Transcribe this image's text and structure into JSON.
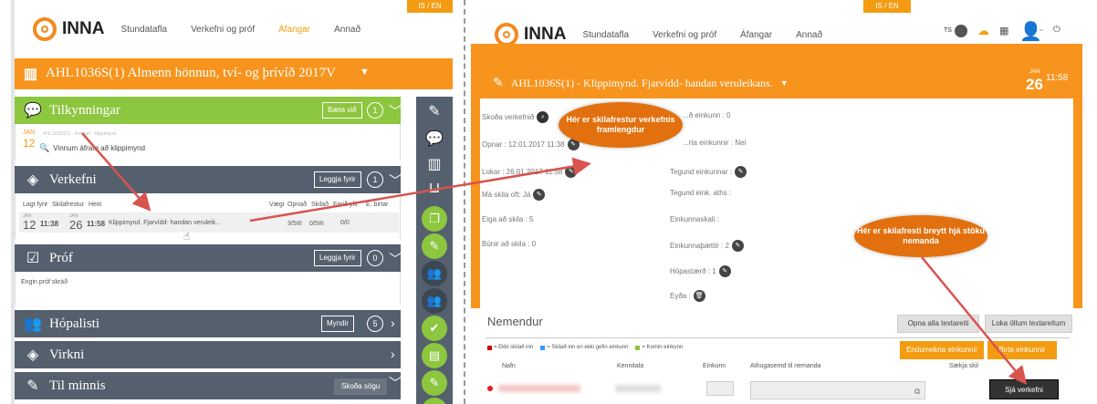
{
  "left": {
    "lang": "IS / EN",
    "logo": "INNA",
    "nav": [
      "Stundatafla",
      "Verkefni og próf",
      "Áfangar",
      "Annað"
    ],
    "course_title": "AHL1036S(1) Almenn hönnun, tví- og þrívíð 2017V",
    "sections": {
      "tilkynningar": {
        "title": "Tilkynningar",
        "button": "Bæta við",
        "count": "1"
      },
      "verkefni": {
        "title": "Verkefni",
        "button": "Leggja fyrir",
        "count": "1"
      },
      "prof": {
        "title": "Próf",
        "button": "Leggja fyrir",
        "count": "0",
        "empty": "Engin próf skráð"
      },
      "hopalisti": {
        "title": "Hópalisti",
        "button": "Myndir",
        "count": "5"
      },
      "virkni": {
        "title": "Virkni"
      },
      "til_minnis": {
        "title": "Til minnis",
        "button": "Skoða sögu"
      }
    },
    "announcement": {
      "month": "JAN",
      "day": "12",
      "text": "Vinnum áfram að klippimynd"
    },
    "task_headers": [
      "Lagt fyrir",
      "Skilafrestur",
      "Heiti",
      "Vægi",
      "Opnað",
      "Skilað",
      "Farið yfir",
      "E. birtar"
    ],
    "task_row": {
      "assigned_month": "JAN",
      "assigned_day": "12",
      "assigned_time": "11:38",
      "due_month": "JAN",
      "due_day": "26",
      "due_time": "11:58",
      "name": "Klippimynd. Fjarvídd- handan veruleik...",
      "opened": "3/5",
      "submitted": "0/5",
      "graded": "0/0"
    }
  },
  "right": {
    "lang": "IS / EN",
    "logo": "INNA",
    "nav": [
      "Stundatafla",
      "Verkefni og próf",
      "Áfangar",
      "Annað"
    ],
    "user_initials": "TS",
    "course_title": "AHL1036S(1) - Klippimynd. Fjarvídd- handan veruleikans.",
    "date_month": "JAN",
    "date_day": "26",
    "date_time": "11:58",
    "fields_left": [
      "Skoða verkefnið",
      "Opnar : 12.01.2017 11:38",
      "Lokar : 26.01.2017 11:58",
      "Má skila oft: Já",
      "Eiga að skila : 5",
      "Búnir að skila : 0"
    ],
    "fields_right": [
      "...ð einkunn : 0",
      "...rta einkunnir : Nei",
      "Tegund einkunnar :",
      "Tegund eink. aths :",
      "Einkunnaskali :",
      "Einkunnaþættir : 2",
      "Hópastærð : 1",
      "Eyða :"
    ],
    "students_title": "Nemendur",
    "btn_open_all": "Opna alla textareiti",
    "btn_close_all": "Loka öllum textareitum",
    "legend": [
      "= Ekki skilað inn",
      "= Skilað inn en ekki gefin einkunn",
      "= Komin einkunn"
    ],
    "legend_colors": [
      "#cc0000",
      "#3399ff",
      "#8dc63f"
    ],
    "btn_recalc": "Endurreikna einkunnir",
    "btn_show": "Birta einkunnir",
    "table_headers": [
      "Nafn",
      "Kennitala",
      "Einkunn",
      "Athugasemd til nemanda",
      "Sækja skil"
    ],
    "btn_view_task": "Sjá verkefni"
  },
  "callouts": {
    "top": "Hér er skilafrestur verkefnis framlengdur",
    "right": "Hér er skilafresti breytt hjá stöku nemanda"
  },
  "colors": {
    "orange": "#f7941d",
    "green": "#8dc63f",
    "slate": "#55606e",
    "callout": "#e2700e",
    "arrow": "#d9534f"
  }
}
